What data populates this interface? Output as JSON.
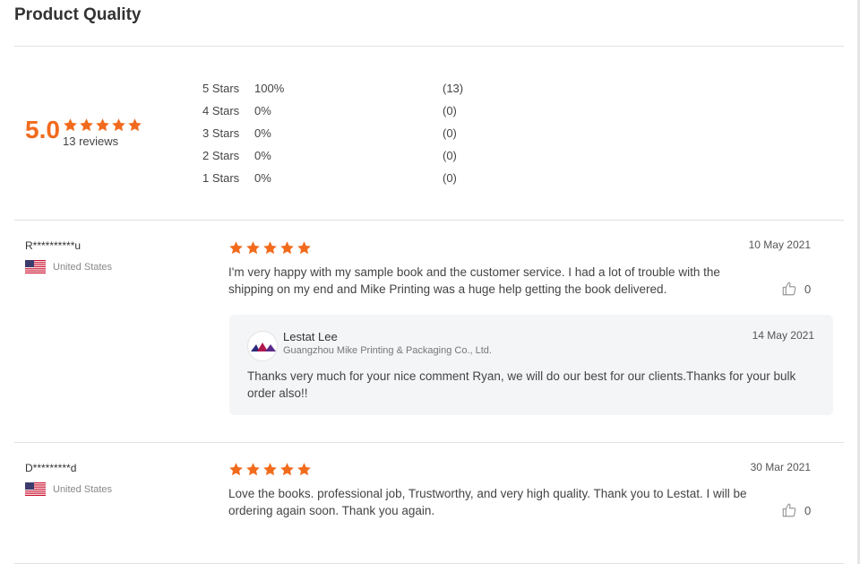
{
  "section": {
    "title": "Product Quality"
  },
  "summary": {
    "score": "5.0",
    "review_count": "13 reviews",
    "star_color": "#f26b1d"
  },
  "breakdown": [
    {
      "label": "5  Stars",
      "percent": "100%",
      "count": "(13)"
    },
    {
      "label": "4  Stars",
      "percent": "0%",
      "count": "(0)"
    },
    {
      "label": "3  Stars",
      "percent": "0%",
      "count": "(0)"
    },
    {
      "label": "2  Stars",
      "percent": "0%",
      "count": "(0)"
    },
    {
      "label": "1  Stars",
      "percent": "0%",
      "count": "(0)"
    }
  ],
  "reviews": [
    {
      "reviewer": "R**********u",
      "country": "United States",
      "flag_icon": "us-flag-icon",
      "rating": 5,
      "date": "10 May 2021",
      "text": "I'm very happy with my sample book and the customer service. I had a lot of trouble with the shipping on my end and Mike Printing was a huge help getting the book delivered.",
      "likes": "0",
      "reply": {
        "name": "Lestat Lee",
        "company": "Guangzhou Mike Printing & Packaging Co., Ltd.",
        "date": "14 May 2021",
        "text": "Thanks very much for your nice comment Ryan,  we will do our best for our clients.Thanks for your bulk order also!!"
      }
    },
    {
      "reviewer": "D*********d",
      "country": "United States",
      "flag_icon": "us-flag-icon",
      "rating": 5,
      "date": "30 Mar 2021",
      "text": "Love the books. professional job, Trustworthy,  and very high quality. Thank you to Lestat. I will be ordering again soon. Thank you again.",
      "likes": "0"
    }
  ]
}
